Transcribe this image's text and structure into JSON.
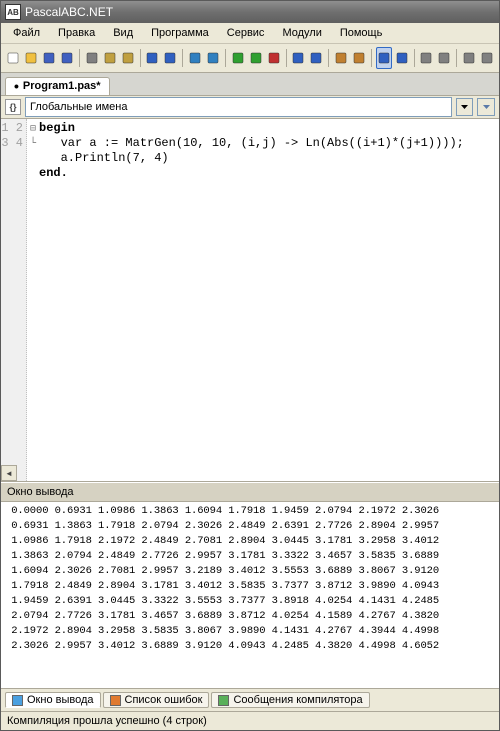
{
  "title": "PascalABC.NET",
  "menu": [
    "Файл",
    "Правка",
    "Вид",
    "Программа",
    "Сервис",
    "Модули",
    "Помощь"
  ],
  "tab": {
    "label": "Program1.pas*",
    "dirty": true
  },
  "scope": {
    "label": "Глобальные имена"
  },
  "gutter": [
    "1",
    "2",
    "3",
    "4"
  ],
  "fold": [
    "⊟",
    " ",
    " ",
    "└"
  ],
  "code": {
    "l1a": "begin",
    "l2": "   var a := MatrGen(10, 10, (i,j) -> Ln(Abs((i+1)*(j+1))));",
    "l3": "   a.Println(7, 4)",
    "l4a": "end."
  },
  "output_header": "Окно вывода",
  "output_rows": [
    " 0.0000 0.6931 1.0986 1.3863 1.6094 1.7918 1.9459 2.0794 2.1972 2.3026",
    " 0.6931 1.3863 1.7918 2.0794 2.3026 2.4849 2.6391 2.7726 2.8904 2.9957",
    " 1.0986 1.7918 2.1972 2.4849 2.7081 2.8904 3.0445 3.1781 3.2958 3.4012",
    " 1.3863 2.0794 2.4849 2.7726 2.9957 3.1781 3.3322 3.4657 3.5835 3.6889",
    " 1.6094 2.3026 2.7081 2.9957 3.2189 3.4012 3.5553 3.6889 3.8067 3.9120",
    " 1.7918 2.4849 2.8904 3.1781 3.4012 3.5835 3.7377 3.8712 3.9890 4.0943",
    " 1.9459 2.6391 3.0445 3.3322 3.5553 3.7377 3.8918 4.0254 4.1431 4.2485",
    " 2.0794 2.7726 3.1781 3.4657 3.6889 3.8712 4.0254 4.1589 4.2767 4.3820",
    " 2.1972 2.8904 3.2958 3.5835 3.8067 3.9890 4.1431 4.2767 4.3944 4.4998",
    " 2.3026 2.9957 3.4012 3.6889 3.9120 4.0943 4.2485 4.3820 4.4998 4.6052"
  ],
  "bottom_tabs": [
    {
      "label": "Окно вывода",
      "color": "#4aa0e0",
      "active": true
    },
    {
      "label": "Список ошибок",
      "color": "#e07a30",
      "active": false
    },
    {
      "label": "Сообщения компилятора",
      "color": "#5ab05a",
      "active": false
    }
  ],
  "status": "Компиляция прошла успешно (4 строк)",
  "toolbar_icons": [
    "new-file-icon",
    "open-icon",
    "save-icon",
    "save-all-icon",
    "sep",
    "cut-icon",
    "copy-icon",
    "paste-icon",
    "sep",
    "undo-icon",
    "redo-icon",
    "sep",
    "nav-back-icon",
    "nav-forward-icon",
    "sep",
    "run-icon",
    "run-no-debug-icon",
    "stop-icon",
    "sep",
    "step-into-icon",
    "step-over-icon",
    "sep",
    "compile-icon",
    "build-icon",
    "sep",
    "form-designer-icon",
    "code-icon",
    "sep",
    "module-icon",
    "class-icon",
    "sep",
    "find-icon",
    "options-icon"
  ],
  "toolbar_active": "form-designer-icon",
  "icon_colors": {
    "new-file-icon": "#ffffff",
    "open-icon": "#f0c040",
    "save-icon": "#4060c0",
    "save-all-icon": "#4060c0",
    "cut-icon": "#808080",
    "copy-icon": "#c0a040",
    "paste-icon": "#c0a040",
    "undo-icon": "#3060c0",
    "redo-icon": "#3060c0",
    "nav-back-icon": "#3080c0",
    "nav-forward-icon": "#3080c0",
    "run-icon": "#30a030",
    "run-no-debug-icon": "#30a030",
    "stop-icon": "#c03030",
    "step-into-icon": "#3060c0",
    "step-over-icon": "#3060c0",
    "compile-icon": "#c08030",
    "build-icon": "#c08030",
    "form-designer-icon": "#3060c0",
    "code-icon": "#3060c0",
    "module-icon": "#808080",
    "class-icon": "#808080",
    "find-icon": "#808080",
    "options-icon": "#808080"
  }
}
